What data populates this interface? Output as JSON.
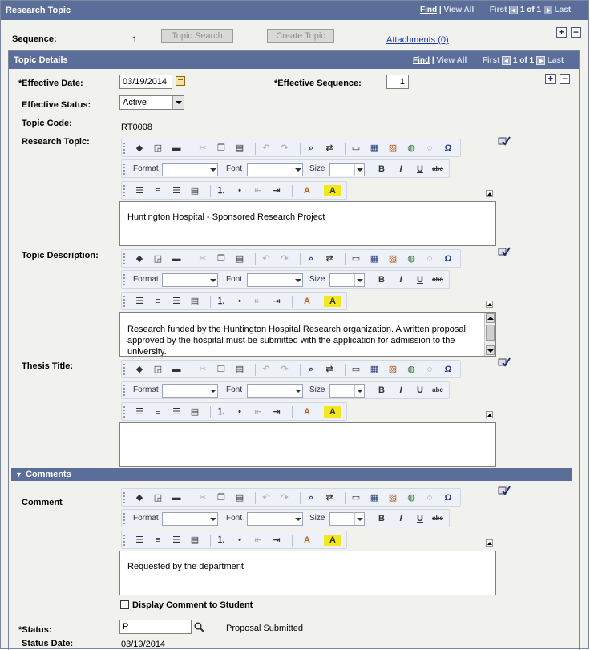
{
  "header": {
    "title": "Research Topic",
    "find": "Find",
    "sep": "|",
    "view_all": "View All",
    "first": "First",
    "page": "1 of 1",
    "last": "Last"
  },
  "top": {
    "sequence_label": "Sequence:",
    "sequence_value": "1",
    "topic_search": "Topic Search",
    "create_topic": "Create Topic",
    "attachments": "Attachments (0)"
  },
  "details": {
    "title": "Topic Details",
    "find": "Find",
    "sep": "|",
    "view_all": "View All",
    "first": "First",
    "page": "1 of 1",
    "last": "Last",
    "effective_date_label": "*Effective Date:",
    "effective_date": "03/19/2014",
    "effective_seq_label": "*Effective Sequence:",
    "effective_seq": "1",
    "effective_status_label": "Effective Status:",
    "effective_status": "Active",
    "topic_code_label": "Topic Code:",
    "topic_code": "RT0008",
    "research_topic_label": "Research Topic:",
    "research_topic_text": "Huntington Hospital - Sponsored Research Project",
    "topic_description_label": "Topic Description:",
    "topic_description_text": " Research funded by the Huntington Hospital Research organization. A written proposal approved by the hospital must be submitted with the application for admission to the university.",
    "thesis_title_label": "Thesis Title:",
    "thesis_title_text": ""
  },
  "toolbar": {
    "format": "Format",
    "font": "Font",
    "size": "Size",
    "bold": "B",
    "italic": "I",
    "underline": "U",
    "strike": "abc",
    "omega": "Ω",
    "font_color": "A",
    "bg_color": "A"
  },
  "comments": {
    "title": "Comments",
    "comment_label": "Comment",
    "comment_text": "Requested by the department",
    "display_to_student": "Display Comment to Student",
    "status_label": "*Status:",
    "status_value": "P",
    "status_desc": "Proposal Submitted",
    "status_date_label": "Status Date:",
    "status_date": "03/19/2014"
  },
  "colors": {
    "header_bg": "#5a6e99",
    "panel_bg": "#f1f1ed",
    "link": "#1a35b8"
  }
}
